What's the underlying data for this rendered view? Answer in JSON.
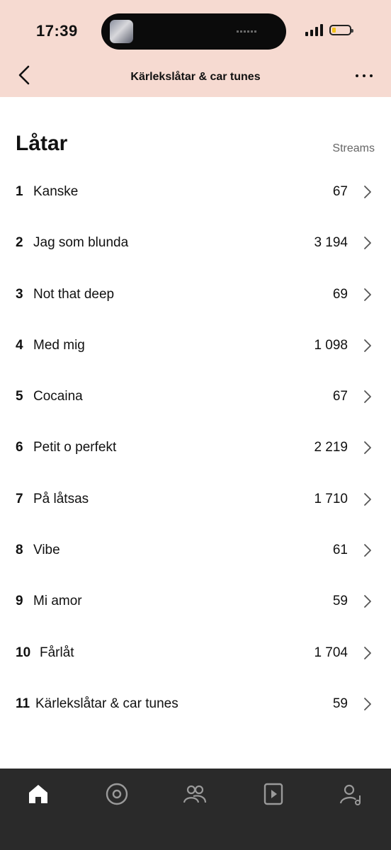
{
  "status_bar": {
    "time": "17:39"
  },
  "header": {
    "title": "Kärlekslåtar & car tunes"
  },
  "section": {
    "title": "Låtar",
    "column_label": "Streams"
  },
  "tracks": [
    {
      "number": "1",
      "name": "Kanske",
      "streams": "67"
    },
    {
      "number": "2",
      "name": "Jag som blunda",
      "streams": "3 194"
    },
    {
      "number": "3",
      "name": "Not that deep",
      "streams": "69"
    },
    {
      "number": "4",
      "name": "Med mig",
      "streams": "1 098"
    },
    {
      "number": "5",
      "name": "Cocaina",
      "streams": "67"
    },
    {
      "number": "6",
      "name": "Petit o perfekt",
      "streams": "2 219"
    },
    {
      "number": "7",
      "name": "På låtsas",
      "streams": "1 710"
    },
    {
      "number": "8",
      "name": "Vibe",
      "streams": "61"
    },
    {
      "number": "9",
      "name": "Mi amor",
      "streams": "59"
    },
    {
      "number": "10",
      "name": "Fårlåt",
      "streams": "1 704"
    },
    {
      "number": "11",
      "name": "Kärlekslåtar & car tunes",
      "streams": "59"
    }
  ],
  "tab_bar": {
    "tabs": [
      {
        "icon": "home-icon",
        "active": true
      },
      {
        "icon": "release-icon",
        "active": false
      },
      {
        "icon": "audience-icon",
        "active": false
      },
      {
        "icon": "video-icon",
        "active": false
      },
      {
        "icon": "profile-icon",
        "active": false
      }
    ]
  },
  "colors": {
    "header_bg": "#f6dad1",
    "tab_bar_bg": "#2a2a2a",
    "tab_active": "#ffffff",
    "tab_inactive": "#9a9a9a"
  }
}
